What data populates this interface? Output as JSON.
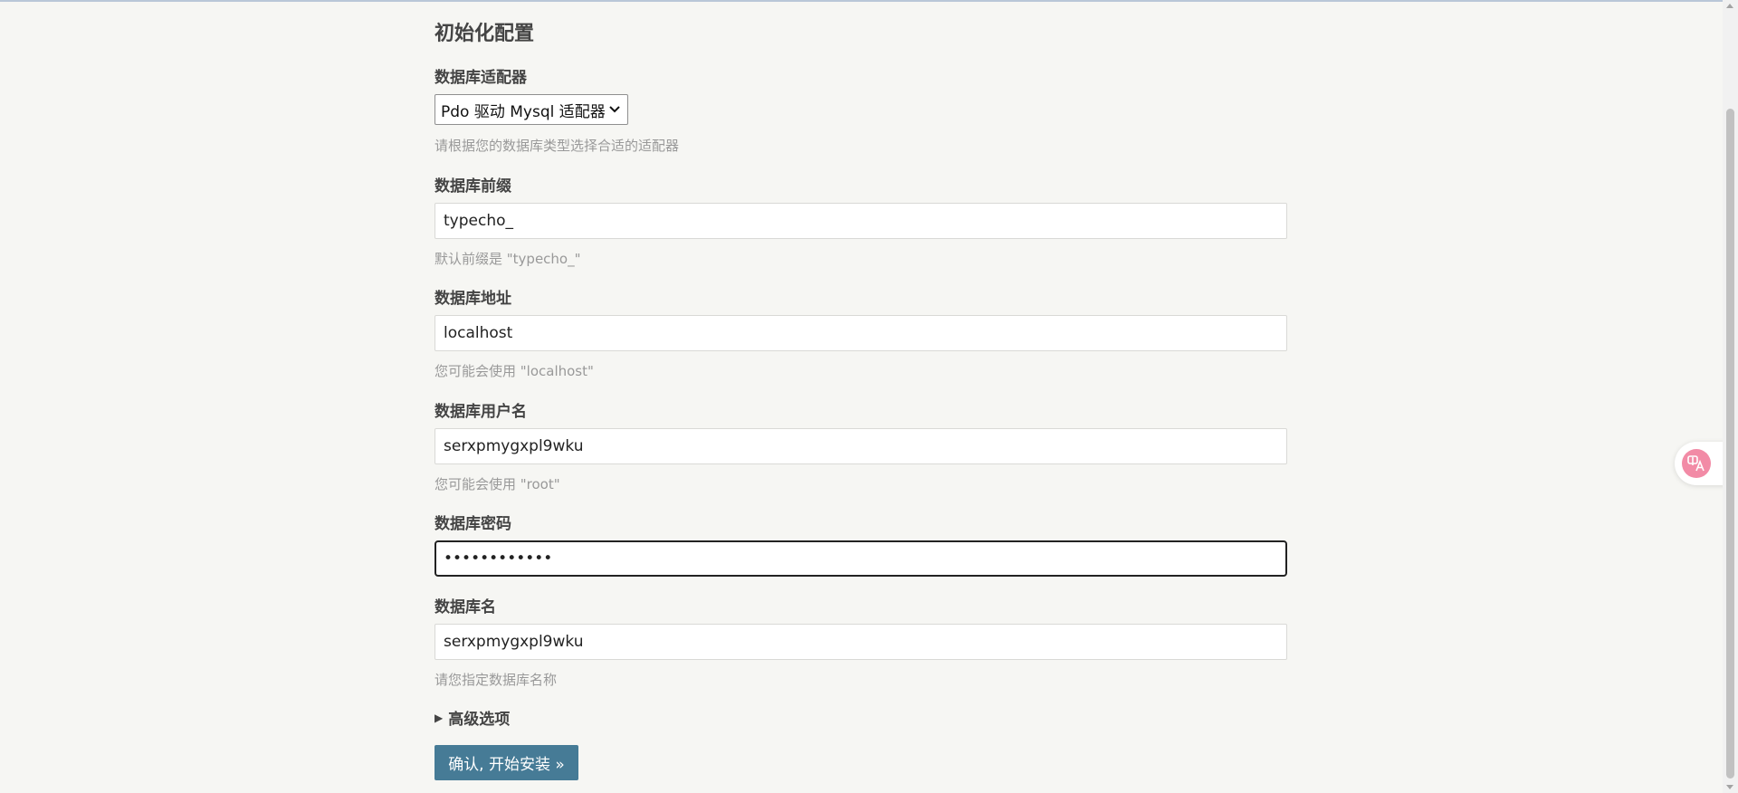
{
  "page": {
    "title": "初始化配置"
  },
  "form": {
    "adapter": {
      "label": "数据库适配器",
      "selected": "Pdo 驱动 Mysql 适配器",
      "description": "请根据您的数据库类型选择合适的适配器"
    },
    "prefix": {
      "label": "数据库前缀",
      "value": "typecho_",
      "description": "默认前缀是 \"typecho_\""
    },
    "host": {
      "label": "数据库地址",
      "value": "localhost",
      "description": "您可能会使用 \"localhost\""
    },
    "user": {
      "label": "数据库用户名",
      "value": "serxpmygxpl9wku",
      "description": "您可能会使用 \"root\""
    },
    "password": {
      "label": "数据库密码",
      "value": "************"
    },
    "dbname": {
      "label": "数据库名",
      "value": "serxpmygxpl9wku",
      "description": "请您指定数据库名称"
    },
    "advanced": {
      "label": "高级选项"
    },
    "submit": {
      "label": "确认, 开始安装 »"
    }
  },
  "colors": {
    "background": "#f6f6f3",
    "button": "#467b96",
    "translate_bubble": "#f28ba6"
  },
  "icons": {
    "select_chevron": "chevron-down-icon",
    "advanced_toggle": "triangle-right-icon",
    "translate": "translate-icon"
  }
}
